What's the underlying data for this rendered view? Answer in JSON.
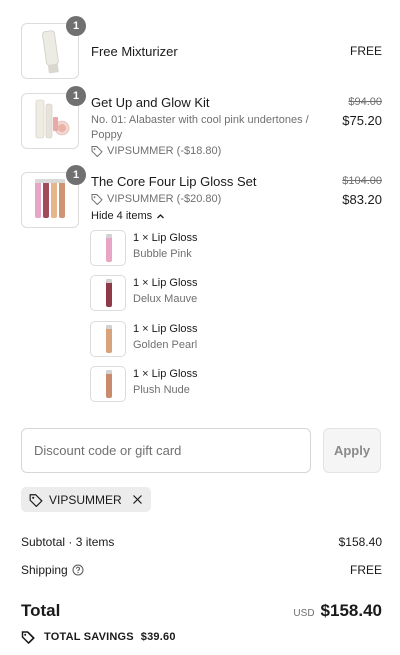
{
  "line_items": [
    {
      "qty": "1",
      "name": "Free Mixturizer",
      "price": "FREE"
    },
    {
      "qty": "1",
      "name": "Get Up and Glow Kit",
      "variant": "No. 01: Alabaster with cool pink undertones / Poppy",
      "discount": "VIPSUMMER (-$18.80)",
      "original_price": "$94.00",
      "price": "$75.20"
    },
    {
      "qty": "1",
      "name": "The Core Four Lip Gloss Set",
      "discount": "VIPSUMMER (-$20.80)",
      "original_price": "$104.00",
      "price": "$83.20",
      "toggle_label": "Hide 4 items",
      "sub_items": [
        {
          "name": "1 × Lip Gloss",
          "variant": "Bubble Pink",
          "color": "#e8a6c4"
        },
        {
          "name": "1 × Lip Gloss",
          "variant": "Delux Mauve",
          "color": "#8e3b47"
        },
        {
          "name": "1 × Lip Gloss",
          "variant": "Golden Pearl",
          "color": "#d8a37a"
        },
        {
          "name": "1 × Lip Gloss",
          "variant": "Plush Nude",
          "color": "#c98a6e"
        }
      ]
    }
  ],
  "discount_field": {
    "placeholder": "Discount code or gift card",
    "apply_label": "Apply"
  },
  "applied_code": "VIPSUMMER",
  "summary": {
    "subtotal_label": "Subtotal · 3 items",
    "subtotal_value": "$158.40",
    "shipping_label": "Shipping",
    "shipping_value": "FREE",
    "total_label": "Total",
    "currency": "USD",
    "total_value": "$158.40",
    "savings_label": "TOTAL SAVINGS",
    "savings_value": "$39.60"
  },
  "icons": {
    "tag": "tag-icon",
    "help": "question-circle-icon",
    "remove": "close-icon",
    "chevron": "chevron-up-icon",
    "savings": "savings-tag-icon"
  }
}
